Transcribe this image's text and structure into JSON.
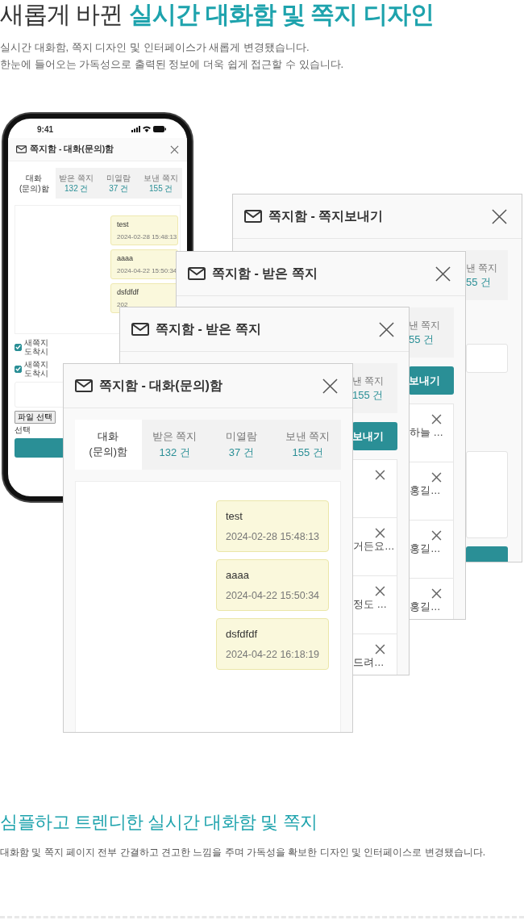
{
  "heading": {
    "plain": "새롭게 바뀐",
    "accent": "실시간 대화함 및 쪽지 디자인"
  },
  "intro": [
    "실시간 대화함, 쪽지 디자인 및 인터페이스가 새롭게 변경됐습니다.",
    "한눈에 들어오는 가독성으로 출력된 정보에 더욱 쉽게 접근할 수 있습니다."
  ],
  "phone": {
    "time": "9:41",
    "title": "쪽지함 - 대화(문의)함",
    "tabs": [
      {
        "label": "대화\n(문의)함",
        "selected": true
      },
      {
        "label": "받은 쪽지",
        "count": "132 건",
        "selected": false
      },
      {
        "label": "미열람",
        "count": "37 건",
        "selected": false
      },
      {
        "label": "보낸 쪽지",
        "count": "155 건",
        "selected": false
      }
    ],
    "messages": [
      {
        "text": "test",
        "time": "2024-02-28 15:48:13"
      },
      {
        "text": "aaaa",
        "time": "2024-04-22 15:50:34"
      },
      {
        "text": "dsfdfdf",
        "time": "202"
      }
    ],
    "checkboxes": [
      {
        "label": "새쪽지 도착시",
        "checked": true
      },
      {
        "label": "새쪽지 도착시",
        "checked": true
      }
    ],
    "file_button": "파일 선택",
    "file_status": "선택"
  },
  "windows": [
    {
      "kind": "compose",
      "title": "쪽지함 - 쪽지보내기",
      "tab": {
        "label": "낸 쪽지",
        "count": "55 건"
      }
    },
    {
      "kind": "inbox",
      "title": "쪽지함 - 받은 쪽지",
      "tab": {
        "label": "낸 쪽지",
        "count": "55 건"
      },
      "button": "보내기",
      "items": [
        {
          "text": "하늘 …"
        },
        {
          "text": "홍길…"
        },
        {
          "text": "홍길…"
        },
        {
          "text": "홍길…"
        }
      ]
    },
    {
      "kind": "inbox",
      "title": "쪽지함 - 받은 쪽지",
      "tab": {
        "label": "낸 쪽지",
        "count": "155 건"
      },
      "button": "보내기",
      "items": [
        {
          "blank": true
        },
        {
          "text": "거든요…"
        },
        {
          "text": "정도 …"
        },
        {
          "text": "드려…"
        }
      ]
    }
  ],
  "chat_window": {
    "title": "쪽지함 - 대화(문의)함",
    "tabs": [
      {
        "label": "대화\n(문의)함",
        "selected": true
      },
      {
        "label": "받은 쪽지",
        "count": "132 건",
        "selected": false
      },
      {
        "label": "미열람",
        "count": "37 건",
        "selected": false
      },
      {
        "label": "보낸 쪽지",
        "count": "155 건",
        "selected": false
      }
    ],
    "messages": [
      {
        "text": "test",
        "time": "2024-02-28 15:48:13"
      },
      {
        "text": "aaaa",
        "time": "2024-04-22 15:50:34"
      },
      {
        "text": "dsfdfdf",
        "time": "2024-04-22 16:18:19"
      }
    ]
  },
  "footer": {
    "title": "심플하고 트렌디한 실시간 대화함 및 쪽지",
    "text": "대화함 및 쪽지 페이지 전부 간결하고 견고한 느낌을 주며 가독성을 확보한 디자인 및 인터페이스로 변경됐습니다."
  }
}
